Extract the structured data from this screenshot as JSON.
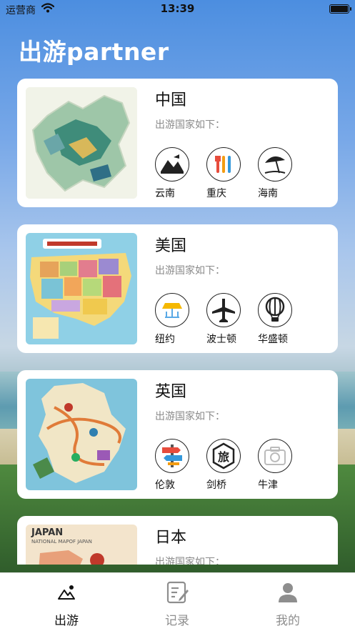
{
  "status_bar": {
    "carrier": "运营商",
    "time": "13:39"
  },
  "header": {
    "title": "出游partner"
  },
  "destinations": [
    {
      "country": "中国",
      "subtitle": "出游国家如下：",
      "cities": [
        {
          "name": "云南",
          "icon": "mountain-temple-icon"
        },
        {
          "name": "重庆",
          "icon": "food-utensils-icon"
        },
        {
          "name": "海南",
          "icon": "beach-umbrella-icon"
        }
      ]
    },
    {
      "country": "美国",
      "subtitle": "出游国家如下：",
      "cities": [
        {
          "name": "纽约",
          "icon": "umbrella-icon"
        },
        {
          "name": "波士顿",
          "icon": "airplane-icon"
        },
        {
          "name": "华盛顿",
          "icon": "hot-air-balloon-icon"
        }
      ]
    },
    {
      "country": "英国",
      "subtitle": "出游国家如下：",
      "cities": [
        {
          "name": "伦敦",
          "icon": "signpost-icon"
        },
        {
          "name": "剑桥",
          "icon": "travel-badge-icon",
          "badge_text": "旅"
        },
        {
          "name": "牛津",
          "icon": "camera-icon"
        }
      ]
    },
    {
      "country": "日本",
      "subtitle": "出游国家如下：",
      "image_text": {
        "line1": "JAPAN",
        "line2": "NATIONAL MAPOF JAPAN"
      },
      "cities": []
    }
  ],
  "tabbar": {
    "tabs": [
      {
        "label": "出游",
        "icon": "landscape-icon",
        "active": true
      },
      {
        "label": "记录",
        "icon": "notebook-edit-icon",
        "active": false
      },
      {
        "label": "我的",
        "icon": "person-icon",
        "active": false
      }
    ]
  },
  "colors": {
    "active_tab": "#111111",
    "inactive_tab": "#8e8e8e",
    "header_text": "#ffffff"
  }
}
